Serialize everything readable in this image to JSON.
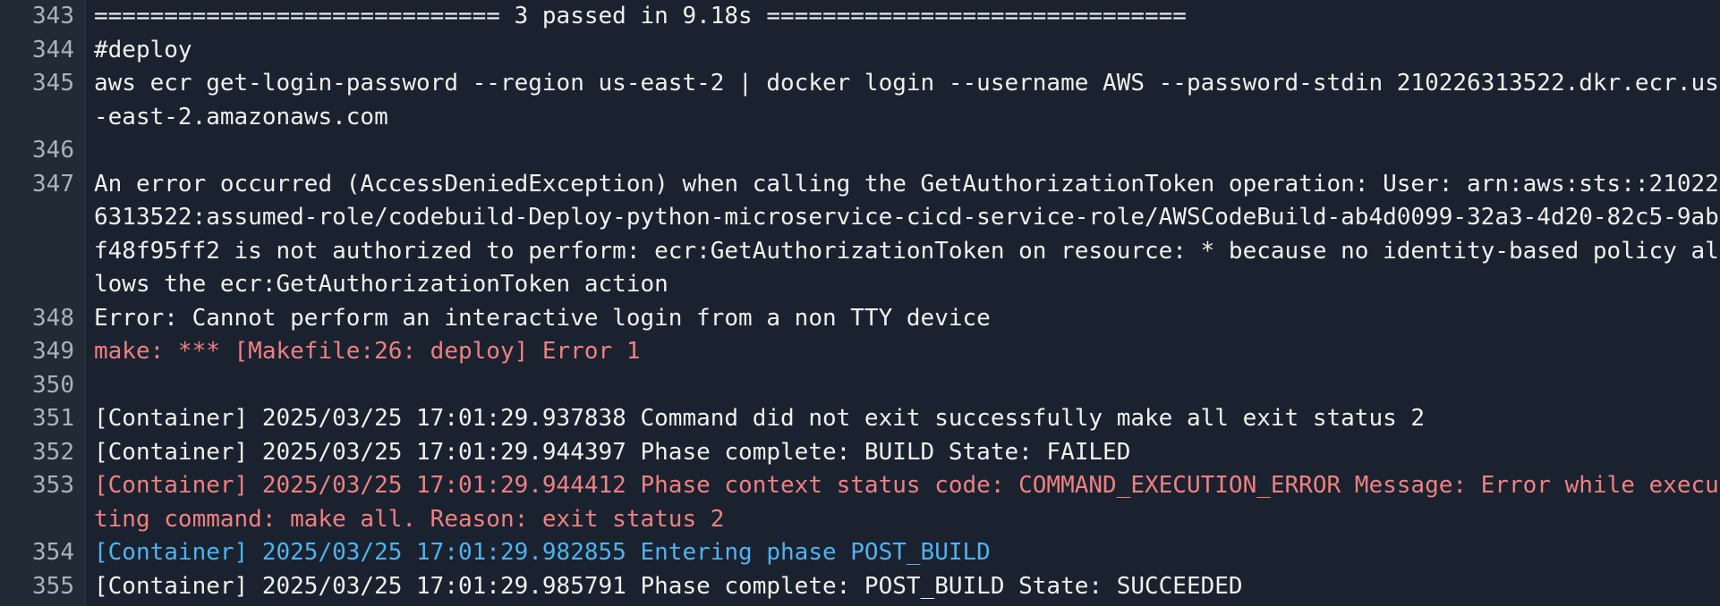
{
  "log": {
    "lines": [
      {
        "n": "343",
        "text": "============================= 3 passed in 9.18s ==============================",
        "color": "default"
      },
      {
        "n": "344",
        "text": "#deploy",
        "color": "default"
      },
      {
        "n": "345",
        "text": "aws ecr get-login-password --region us-east-2 | docker login --username AWS --password-stdin 210226313522.dkr.ecr.us-east-2.amazonaws.com",
        "color": "default"
      },
      {
        "n": "346",
        "text": "",
        "color": "default"
      },
      {
        "n": "347",
        "text": "An error occurred (AccessDeniedException) when calling the GetAuthorizationToken operation: User: arn:aws:sts::210226313522:assumed-role/codebuild-Deploy-python-microservice-cicd-service-role/AWSCodeBuild-ab4d0099-32a3-4d20-82c5-9abf48f95ff2 is not authorized to perform: ecr:GetAuthorizationToken on resource: * because no identity-based policy allows the ecr:GetAuthorizationToken action",
        "color": "default"
      },
      {
        "n": "348",
        "text": "Error: Cannot perform an interactive login from a non TTY device",
        "color": "default"
      },
      {
        "n": "349",
        "text": "make: *** [Makefile:26: deploy] Error 1",
        "color": "error"
      },
      {
        "n": "350",
        "text": "",
        "color": "default"
      },
      {
        "n": "351",
        "text": "[Container] 2025/03/25 17:01:29.937838 Command did not exit successfully make all exit status 2",
        "color": "default"
      },
      {
        "n": "352",
        "text": "[Container] 2025/03/25 17:01:29.944397 Phase complete: BUILD State: FAILED",
        "color": "default"
      },
      {
        "n": "353",
        "text": "[Container] 2025/03/25 17:01:29.944412 Phase context status code: COMMAND_EXECUTION_ERROR Message: Error while executing command: make all. Reason: exit status 2",
        "color": "error"
      },
      {
        "n": "354",
        "text": "[Container] 2025/03/25 17:01:29.982855 Entering phase POST_BUILD",
        "color": "info"
      },
      {
        "n": "355",
        "text": "[Container] 2025/03/25 17:01:29.985791 Phase complete: POST_BUILD State: SUCCEEDED",
        "color": "default"
      }
    ]
  }
}
